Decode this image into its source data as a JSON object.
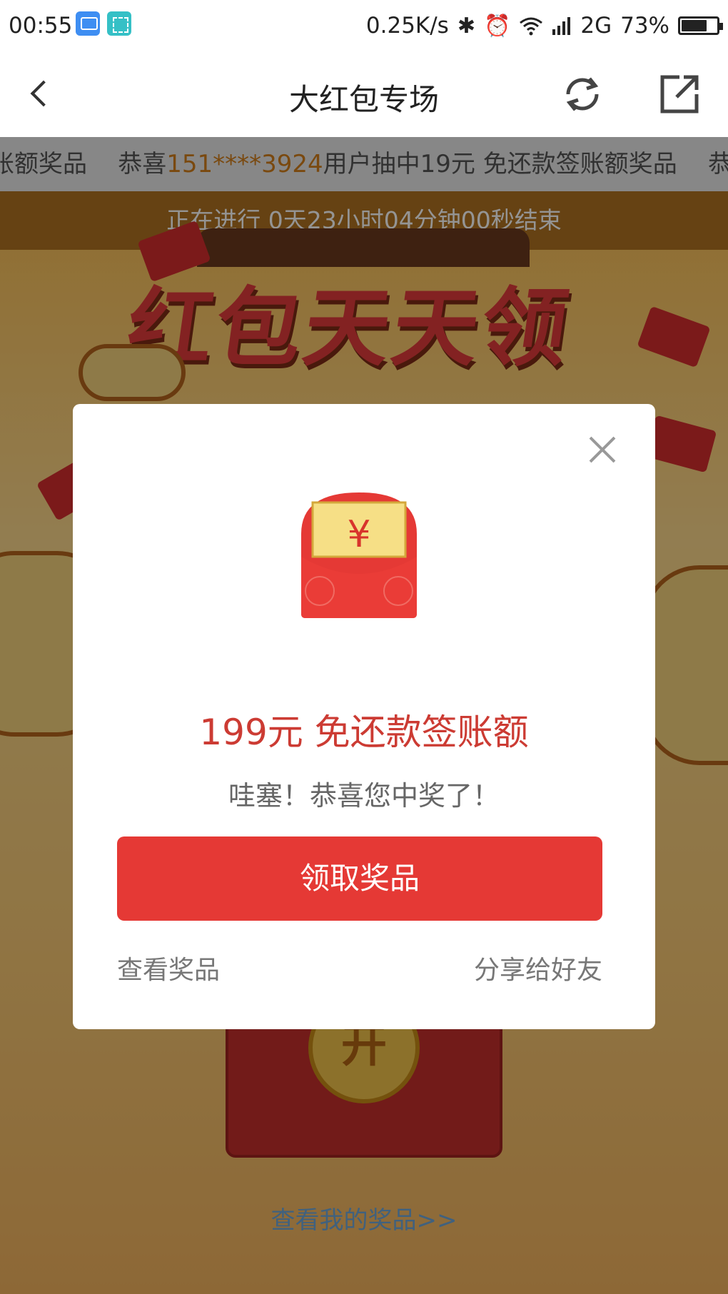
{
  "status_bar": {
    "time": "00:55",
    "network_speed": "0.25K/s",
    "network_type": "2G",
    "battery_percent": "73%",
    "battery_level": 0.73
  },
  "navbar": {
    "title": "大红包专场",
    "icons": [
      "back-icon",
      "refresh-icon",
      "share-icon"
    ]
  },
  "ticker": {
    "lead": "账额奖品",
    "prefix": "恭喜",
    "phone": "151****3924",
    "suffix": "用户抽中19元 免还款签账额奖品",
    "tail": "恭喜"
  },
  "countdown": {
    "text": "正在进行 0天23小时04分钟00秒结束"
  },
  "banner": {
    "title": "红包天天领",
    "open_label": "开"
  },
  "footer": {
    "my_prizes_link": "查看我的奖品>>"
  },
  "modal": {
    "currency_symbol": "¥",
    "prize_title": "199元 免还款签账额",
    "congrats": "哇塞！恭喜您中奖了！",
    "claim_button": "领取奖品",
    "view_prize_link": "查看奖品",
    "share_link": "分享给好友"
  },
  "colors": {
    "primary_red": "#e53935",
    "prize_text_red": "#cc3b33",
    "ticker_highlight": "#d27f1a"
  }
}
